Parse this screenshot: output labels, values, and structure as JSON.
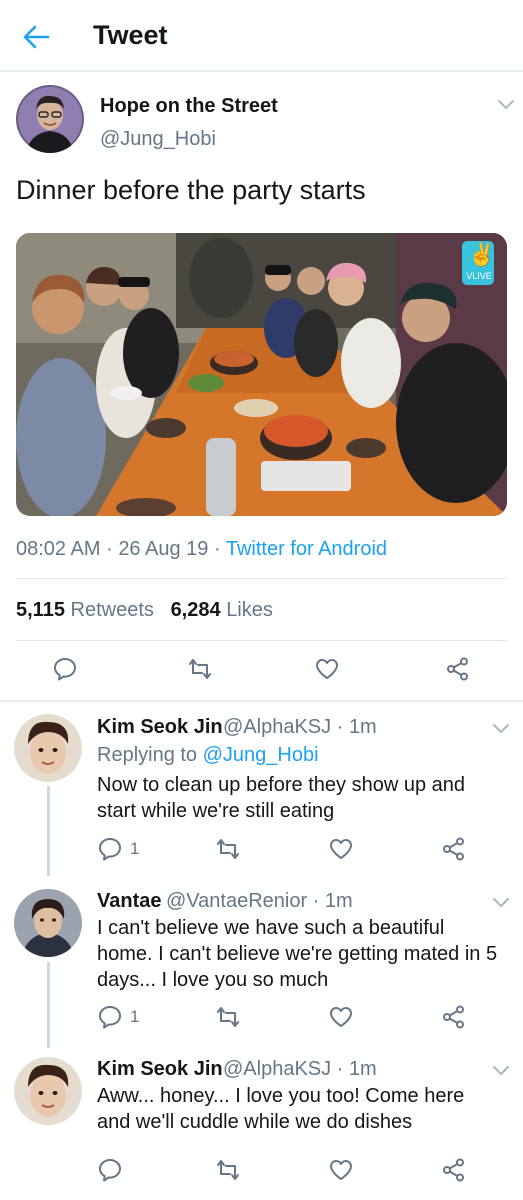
{
  "header": {
    "title": "Tweet"
  },
  "main_tweet": {
    "display_name": "Hope on the Street",
    "handle": "@Jung_Hobi",
    "text": "Dinner before the party starts",
    "media_badge": "VLIVE",
    "time": "08:02 AM",
    "date": "26 Aug 19",
    "source": "Twitter for Android",
    "retweets_count": "5,115",
    "retweets_label": "Retweets",
    "likes_count": "6,284",
    "likes_label": "Likes"
  },
  "replies": [
    {
      "display_name": "Kim Seok Jin",
      "handle": "@AlphaKSJ",
      "time": "1m",
      "replying_prefix": "Replying to",
      "replying_to": "@Jung_Hobi",
      "text": "Now to clean up before they show up and start while we're still eating",
      "reply_count": "1"
    },
    {
      "display_name": "Vantae",
      "handle": "@VantaeRenior",
      "time": "1m",
      "text": "I can't believe we have such a beautiful home. I can't believe we're getting mated in 5 days... I love you so much",
      "reply_count": "1"
    },
    {
      "display_name": "Kim Seok Jin",
      "handle": "@AlphaKSJ",
      "time": "1m",
      "text": "Aww... honey... I love you too! Come here and we'll cuddle while we do dishes",
      "reply_count": ""
    }
  ],
  "separator": "·",
  "colors": {
    "accent": "#1da1f2",
    "secondary": "#657786",
    "divider": "#e1e8ed",
    "icon": "#657786"
  },
  "icons": [
    "back-arrow-icon",
    "chevron-down-icon",
    "reply-icon",
    "retweet-icon",
    "like-icon",
    "share-icon"
  ]
}
